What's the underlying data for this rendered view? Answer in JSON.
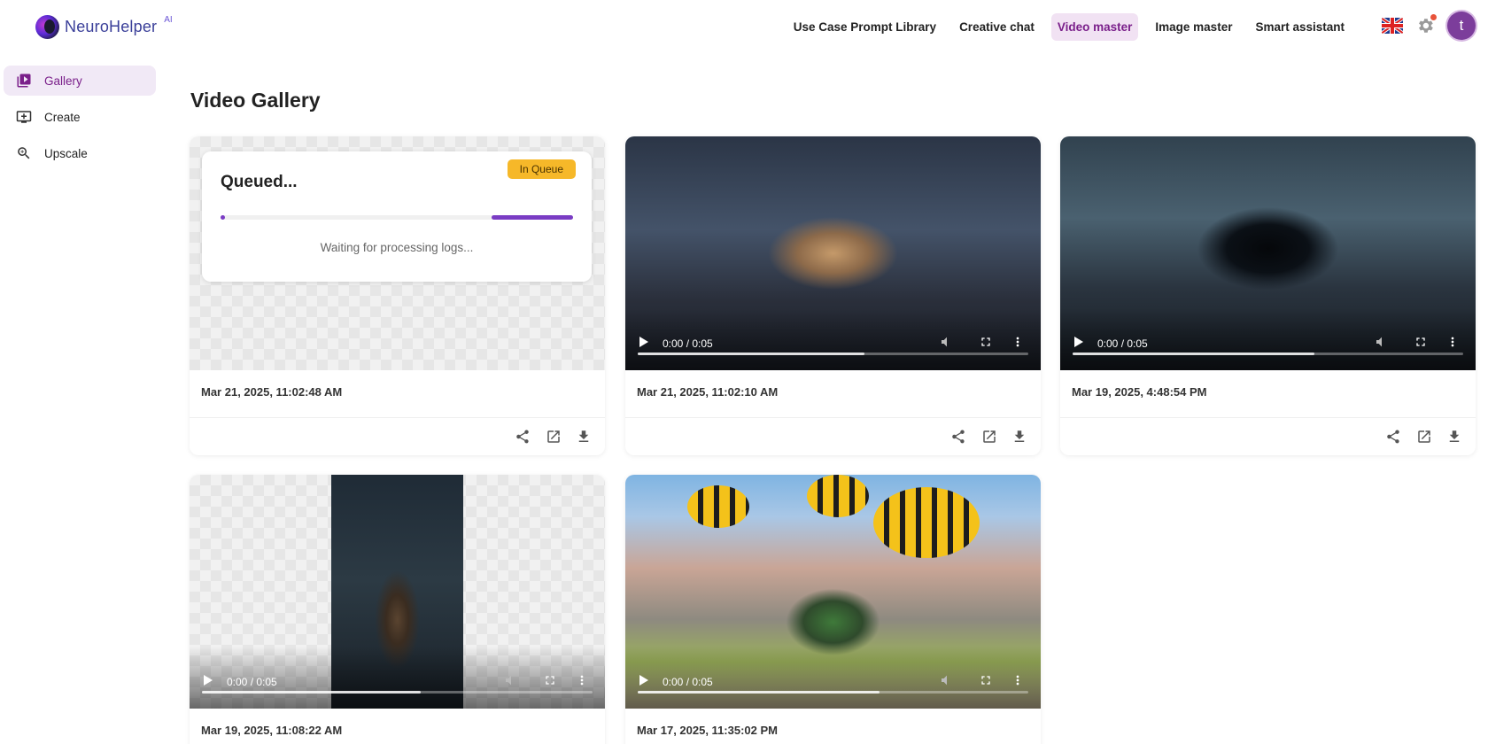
{
  "app": {
    "logo_text": "NeuroHelper",
    "logo_superscript": "AI"
  },
  "nav": {
    "items": [
      {
        "label": "Use Case Prompt Library",
        "active": false
      },
      {
        "label": "Creative chat",
        "active": false
      },
      {
        "label": "Video master",
        "active": true
      },
      {
        "label": "Image master",
        "active": false
      },
      {
        "label": "Smart assistant",
        "active": false
      }
    ],
    "language_icon": "uk-flag-icon",
    "settings_icon": "gear-icon",
    "avatar_initial": "t"
  },
  "sidebar": {
    "items": [
      {
        "label": "Gallery",
        "icon": "gallery-icon",
        "active": true
      },
      {
        "label": "Create",
        "icon": "create-icon",
        "active": false
      },
      {
        "label": "Upscale",
        "icon": "upscale-icon",
        "active": false
      }
    ]
  },
  "page": {
    "title": "Video Gallery"
  },
  "queue_card": {
    "badge": "In Queue",
    "title": "Queued...",
    "log_text": "Waiting for processing logs...",
    "date": "Mar 21, 2025, 11:02:48 AM"
  },
  "videos": [
    {
      "time": "0:00 / 0:05",
      "date": "Mar 21, 2025, 11:02:10 AM",
      "progress": 0.58
    },
    {
      "time": "0:00 / 0:05",
      "date": "Mar 19, 2025, 4:48:54 PM",
      "progress": 0.62
    },
    {
      "time": "0:00 / 0:05",
      "date": "Mar 19, 2025, 11:08:22 AM",
      "progress": 0.56
    },
    {
      "time": "0:00 / 0:05",
      "date": "Mar 17, 2025, 11:35:02 PM",
      "progress": 0.62
    }
  ],
  "colors": {
    "accent": "#7a1f8a",
    "active_bg": "#f1e2f3",
    "badge": "#f6b829",
    "progress": "#7a3cc4"
  }
}
